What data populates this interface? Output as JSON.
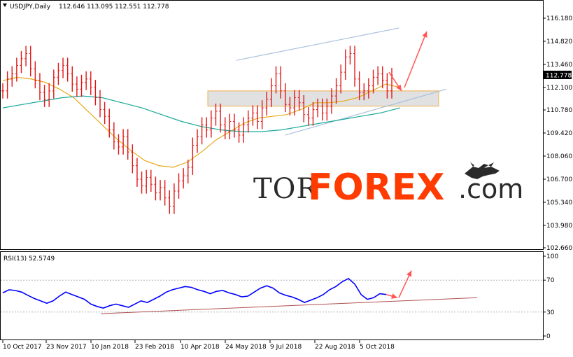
{
  "header": {
    "symbol": "USDJPY,Daily",
    "ohlc": "112.646 113.095 112.551 112.778"
  },
  "rsi_header": {
    "label": "RSI(13) 52.5749"
  },
  "price_badge": "112.778",
  "watermark": {
    "tor": "TOR",
    "forex": "FOREX",
    "com": ".com"
  },
  "colors": {
    "bars": "#e01818",
    "ma_fast": "#e8a818",
    "ma_slow": "#18a898",
    "rsi": "#0000ff",
    "arrow": "#ff5555",
    "channel": "#a8c0dc",
    "zone_border": "#f0b050",
    "trend_rsi": "#b05050"
  },
  "chart_data": [
    {
      "type": "ohlc",
      "price_axis": {
        "ylim": [
          102.66,
          116.18
        ],
        "ticks": [
          "116.180",
          "114.820",
          "113.460",
          "112.100",
          "110.780",
          "109.420",
          "108.060",
          "106.700",
          "105.340",
          "103.980",
          "102.660"
        ]
      },
      "x_ticks": [
        "10 Oct 2017",
        "23 Nov 2017",
        "10 Jan 2018",
        "23 Feb 2018",
        "10 Apr 2018",
        "24 May 2018",
        "9 Jul 2018",
        "22 Aug 2018",
        "5 Oct 2018"
      ],
      "series": [
        {
          "kind": "bars",
          "values": [
            111.9,
            112.6,
            112.9,
            113.4,
            113.8,
            114.1,
            113.2,
            112.5,
            111.8,
            111.4,
            111.9,
            112.7,
            113.1,
            113.4,
            112.9,
            112.3,
            112.0,
            112.4,
            112.6,
            112.1,
            111.5,
            110.8,
            110.4,
            109.6,
            108.9,
            108.6,
            109.2,
            108.3,
            107.5,
            106.7,
            106.3,
            106.8,
            106.4,
            105.9,
            106.2,
            105.6,
            105.1,
            106.0,
            106.6,
            106.9,
            107.4,
            108.7,
            109.2,
            109.9,
            109.6,
            110.3,
            110.7,
            109.9,
            109.5,
            110.1,
            109.6,
            109.3,
            109.9,
            110.3,
            110.6,
            110.1,
            110.9,
            111.4,
            112.2,
            112.9,
            111.9,
            111.1,
            110.9,
            111.5,
            111.2,
            110.5,
            110.3,
            110.8,
            111.0,
            110.6,
            111.0,
            111.6,
            112.2,
            113.0,
            113.9,
            114.1,
            112.6,
            111.8,
            111.9,
            112.2,
            112.7,
            112.9,
            112.5,
            111.9,
            112.8
          ]
        },
        {
          "kind": "ma_fast",
          "values": [
            112.5,
            112.7,
            112.6,
            112.4,
            112.0,
            111.5,
            110.7,
            109.9,
            109.1,
            108.4,
            107.8,
            107.5,
            107.4,
            107.7,
            108.3,
            109.0,
            109.5,
            110.0,
            110.3,
            110.4,
            110.5,
            110.8,
            111.2,
            111.2,
            111.3,
            111.5,
            111.9,
            112.3,
            112.1
          ]
        },
        {
          "kind": "ma_slow",
          "values": [
            110.9,
            111.1,
            111.3,
            111.5,
            111.6,
            111.5,
            111.2,
            110.9,
            110.5,
            110.1,
            109.8,
            109.6,
            109.5,
            109.5,
            109.6,
            109.8,
            110.0,
            110.2,
            110.4,
            110.6,
            110.9
          ]
        },
        {
          "kind": "zone",
          "values": [
            111.0,
            111.9
          ]
        },
        {
          "kind": "arrow",
          "name": "up",
          "values": [
            112.1,
            115.4
          ]
        },
        {
          "kind": "arrow",
          "name": "down",
          "values": [
            113.0,
            111.9
          ]
        }
      ]
    },
    {
      "type": "line",
      "ylim": [
        0,
        100
      ],
      "ticks": [
        "100",
        "70",
        "30",
        "0"
      ],
      "series": [
        {
          "kind": "rsi",
          "values": [
            54,
            58,
            57,
            55,
            51,
            47,
            44,
            41,
            44,
            50,
            55,
            52,
            49,
            46,
            40,
            37,
            35,
            38,
            40,
            38,
            36,
            40,
            44,
            42,
            46,
            50,
            55,
            58,
            60,
            62,
            61,
            58,
            56,
            53,
            56,
            57,
            54,
            52,
            49,
            50,
            55,
            60,
            63,
            60,
            54,
            51,
            49,
            46,
            42,
            45,
            48,
            52,
            58,
            62,
            68,
            72,
            65,
            52,
            46,
            48,
            53,
            52
          ]
        },
        {
          "kind": "trendline",
          "values": [
            28,
            48
          ]
        },
        {
          "kind": "arrow",
          "values": [
            48,
            70
          ]
        }
      ]
    }
  ]
}
